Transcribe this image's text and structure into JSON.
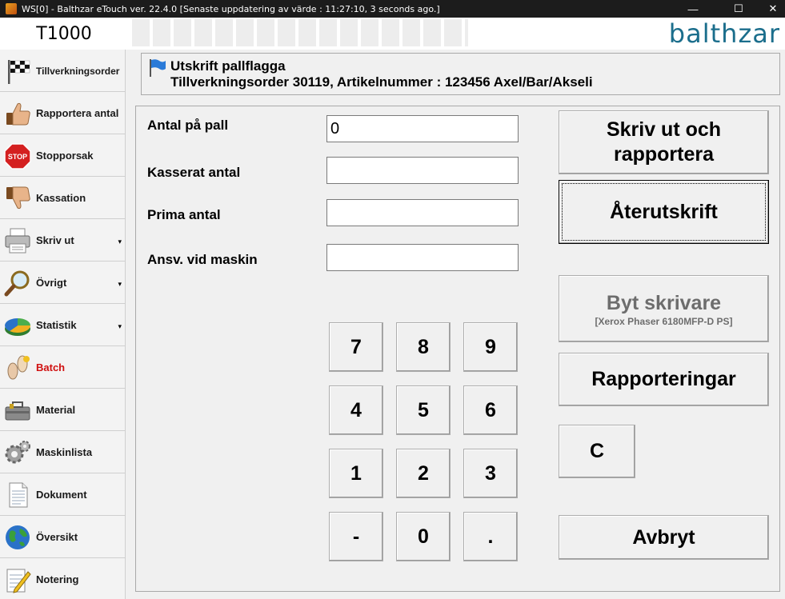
{
  "window": {
    "title": "WS[0] - Balthzar eTouch ver. 22.4.0  [Senaste uppdatering av värde : 11:27:10, 3 seconds ago.]",
    "controls": {
      "minimize": "—",
      "maximize": "☐",
      "close": "✕"
    }
  },
  "header": {
    "machine": "T1000",
    "brand": "balthzar",
    "brand_color": "#1b6e8c"
  },
  "sidebar": {
    "items": [
      {
        "label": "Tillverkningsorder",
        "icon": "checkered-flag-icon"
      },
      {
        "label": "Rapportera antal",
        "icon": "thumbs-up-icon"
      },
      {
        "label": "Stopporsak",
        "icon": "stop-sign-icon"
      },
      {
        "label": "Kassation",
        "icon": "thumbs-down-icon"
      },
      {
        "label": "Skriv ut",
        "icon": "printer-icon",
        "has_caret": true
      },
      {
        "label": "Övrigt",
        "icon": "magnifier-icon",
        "has_caret": true
      },
      {
        "label": "Statistik",
        "icon": "pie-chart-icon",
        "has_caret": true
      },
      {
        "label": "Batch",
        "icon": "footprints-icon",
        "active": true
      },
      {
        "label": "Material",
        "icon": "toolbox-icon"
      },
      {
        "label": "Maskinlista",
        "icon": "gears-icon"
      },
      {
        "label": "Dokument",
        "icon": "document-icon"
      },
      {
        "label": "Översikt",
        "icon": "globe-icon"
      },
      {
        "label": "Notering",
        "icon": "notepad-pencil-icon"
      }
    ],
    "caret": "▾",
    "active_color": "#d01010"
  },
  "info": {
    "title": "Utskrift pallflagga",
    "subtitle": "Tillverkningsorder 30119, Artikelnummer : 123456 Axel/Bar/Akseli"
  },
  "form": {
    "fields": [
      {
        "label": "Antal på pall",
        "value": "0"
      },
      {
        "label": "Kasserat antal",
        "value": ""
      },
      {
        "label": "Prima antal",
        "value": ""
      },
      {
        "label": "Ansv. vid maskin",
        "value": ""
      }
    ]
  },
  "keypad": {
    "keys": [
      "7",
      "8",
      "9",
      "4",
      "5",
      "6",
      "1",
      "2",
      "3",
      "-",
      "0",
      "."
    ]
  },
  "actions": {
    "print_report_line1": "Skriv ut och",
    "print_report_line2": "rapportera",
    "reprint": "Återutskrift",
    "change_printer": "Byt skrivare",
    "printer_name": "[Xerox Phaser 6180MFP-D PS]",
    "reports": "Rapporteringar",
    "clear": "C",
    "cancel": "Avbryt"
  }
}
